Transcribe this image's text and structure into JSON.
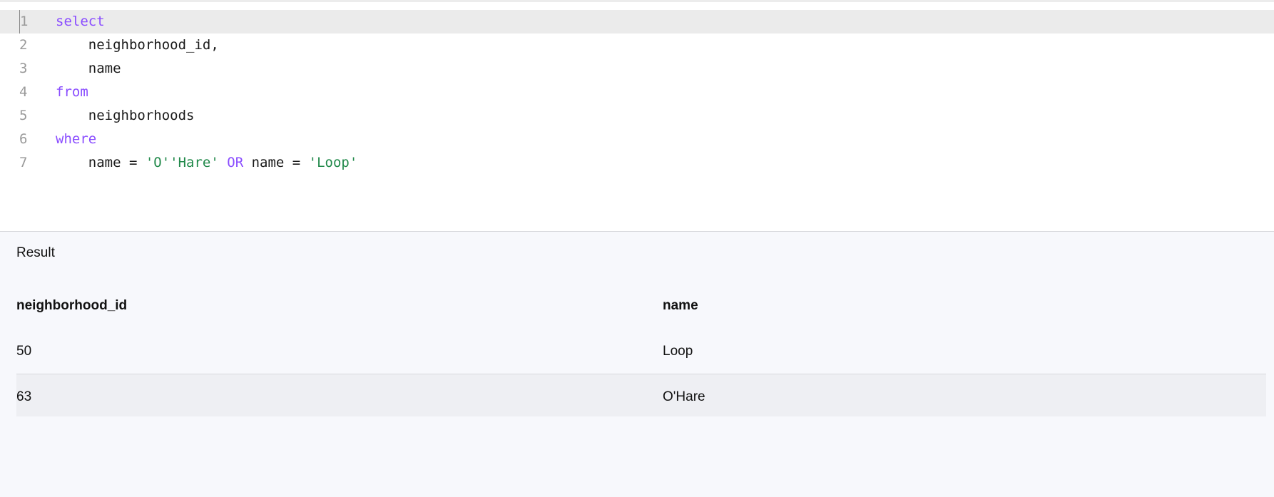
{
  "editor": {
    "lines": [
      {
        "num": "1",
        "tokens": [
          {
            "t": "select",
            "k": "kw"
          }
        ]
      },
      {
        "num": "2",
        "tokens": [
          {
            "t": "    neighborhood_id,",
            "k": ""
          }
        ]
      },
      {
        "num": "3",
        "tokens": [
          {
            "t": "    name",
            "k": ""
          }
        ]
      },
      {
        "num": "4",
        "tokens": [
          {
            "t": "from",
            "k": "kw"
          }
        ]
      },
      {
        "num": "5",
        "tokens": [
          {
            "t": "    neighborhoods",
            "k": ""
          }
        ]
      },
      {
        "num": "6",
        "tokens": [
          {
            "t": "where",
            "k": "kw"
          }
        ]
      },
      {
        "num": "7",
        "tokens": [
          {
            "t": "    name = ",
            "k": ""
          },
          {
            "t": "'O''Hare'",
            "k": "str"
          },
          {
            "t": " ",
            "k": ""
          },
          {
            "t": "OR",
            "k": "kw"
          },
          {
            "t": " name = ",
            "k": ""
          },
          {
            "t": "'Loop'",
            "k": "str"
          }
        ]
      }
    ],
    "colors": {
      "keyword": "#8a4dff",
      "string": "#21894a"
    }
  },
  "result": {
    "title": "Result",
    "columns": [
      "neighborhood_id",
      "name"
    ],
    "rows": [
      [
        "50",
        "Loop"
      ],
      [
        "63",
        "O'Hare"
      ]
    ]
  }
}
